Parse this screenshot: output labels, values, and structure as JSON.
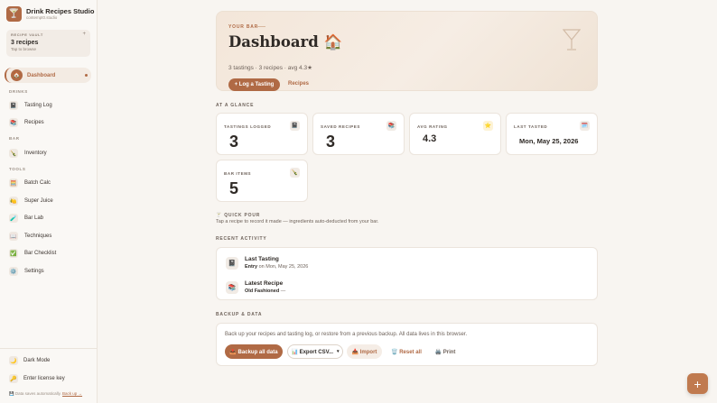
{
  "brand": {
    "name": "Drink Recipes Studio",
    "sub": "contempt0.studio",
    "logo_icon": "🍸"
  },
  "vault": {
    "label": "RECIPE VAULT",
    "count": "3 recipes",
    "hint": "Tap to browse",
    "plus": "+"
  },
  "nav": {
    "active": {
      "label": "Dashboard",
      "icon": "🏠"
    },
    "sections": {
      "drinks": "DRINKS",
      "bar": "BAR",
      "tools": "TOOLS"
    },
    "items": {
      "tasting_log": {
        "label": "Tasting Log",
        "icon": "📓"
      },
      "recipes": {
        "label": "Recipes",
        "icon": "📚"
      },
      "inventory": {
        "label": "Inventory",
        "icon": "🍾"
      },
      "batch_calc": {
        "label": "Batch Calc",
        "icon": "🧮"
      },
      "super_juice": {
        "label": "Super Juice",
        "icon": "🍋"
      },
      "bar_lab": {
        "label": "Bar Lab",
        "icon": "🧪"
      },
      "techniques": {
        "label": "Techniques",
        "icon": "📖"
      },
      "bar_checklist": {
        "label": "Bar Checklist",
        "icon": "✅"
      },
      "settings": {
        "label": "Settings",
        "icon": "⚙️"
      }
    },
    "footer": {
      "dark_mode": {
        "label": "Dark Mode",
        "icon": "🌙"
      },
      "license": {
        "label": "Enter license key",
        "icon": "🔑"
      },
      "saved_note": "💾 Data saves automatically. ",
      "backup_link": "Back up →"
    }
  },
  "hero": {
    "eyebrow": "YOUR BAR",
    "title": "Dashboard 🏠",
    "subtitle": "3 tastings · 3 recipes · avg 4.3★",
    "cta": "+ Log a Tasting",
    "link": "Recipes"
  },
  "glance": {
    "title": "AT A GLANCE",
    "stats": [
      {
        "label": "TASTINGS LOGGED",
        "value": "3",
        "icon": "📓"
      },
      {
        "label": "SAVED RECIPES",
        "value": "3",
        "icon": "📚"
      },
      {
        "label": "AVG RATING",
        "value": "4.3",
        "icon": "⭐"
      },
      {
        "label": "LAST TASTED",
        "value": "Mon, May 25, 2026",
        "icon": "🗓️"
      },
      {
        "label": "BAR ITEMS",
        "value": "5",
        "icon": "🍾"
      }
    ]
  },
  "quick_pour": {
    "title": "🍸 QUICK POUR",
    "subtitle": "Tap a recipe to record it made — ingredients auto-deducted from your bar."
  },
  "activity": {
    "title": "RECENT ACTIVITY",
    "items": [
      {
        "title": "Last Tasting",
        "strong": "Entry",
        "rest": " on Mon, May 25, 2026",
        "icon": "📓"
      },
      {
        "title": "Latest Recipe",
        "strong": "Old Fashioned",
        "rest": " —",
        "icon": "📚"
      }
    ]
  },
  "backup": {
    "title": "BACKUP & DATA",
    "text": "Back up your recipes and tasting log, or restore from a previous backup. All data lives in this browser.",
    "backup_all": "📤 Backup all data",
    "export": "📊 Export CSV...",
    "import": "📥 Import",
    "reset": "🗑️ Reset all",
    "print": "🖨️ Print"
  },
  "fab": "+"
}
